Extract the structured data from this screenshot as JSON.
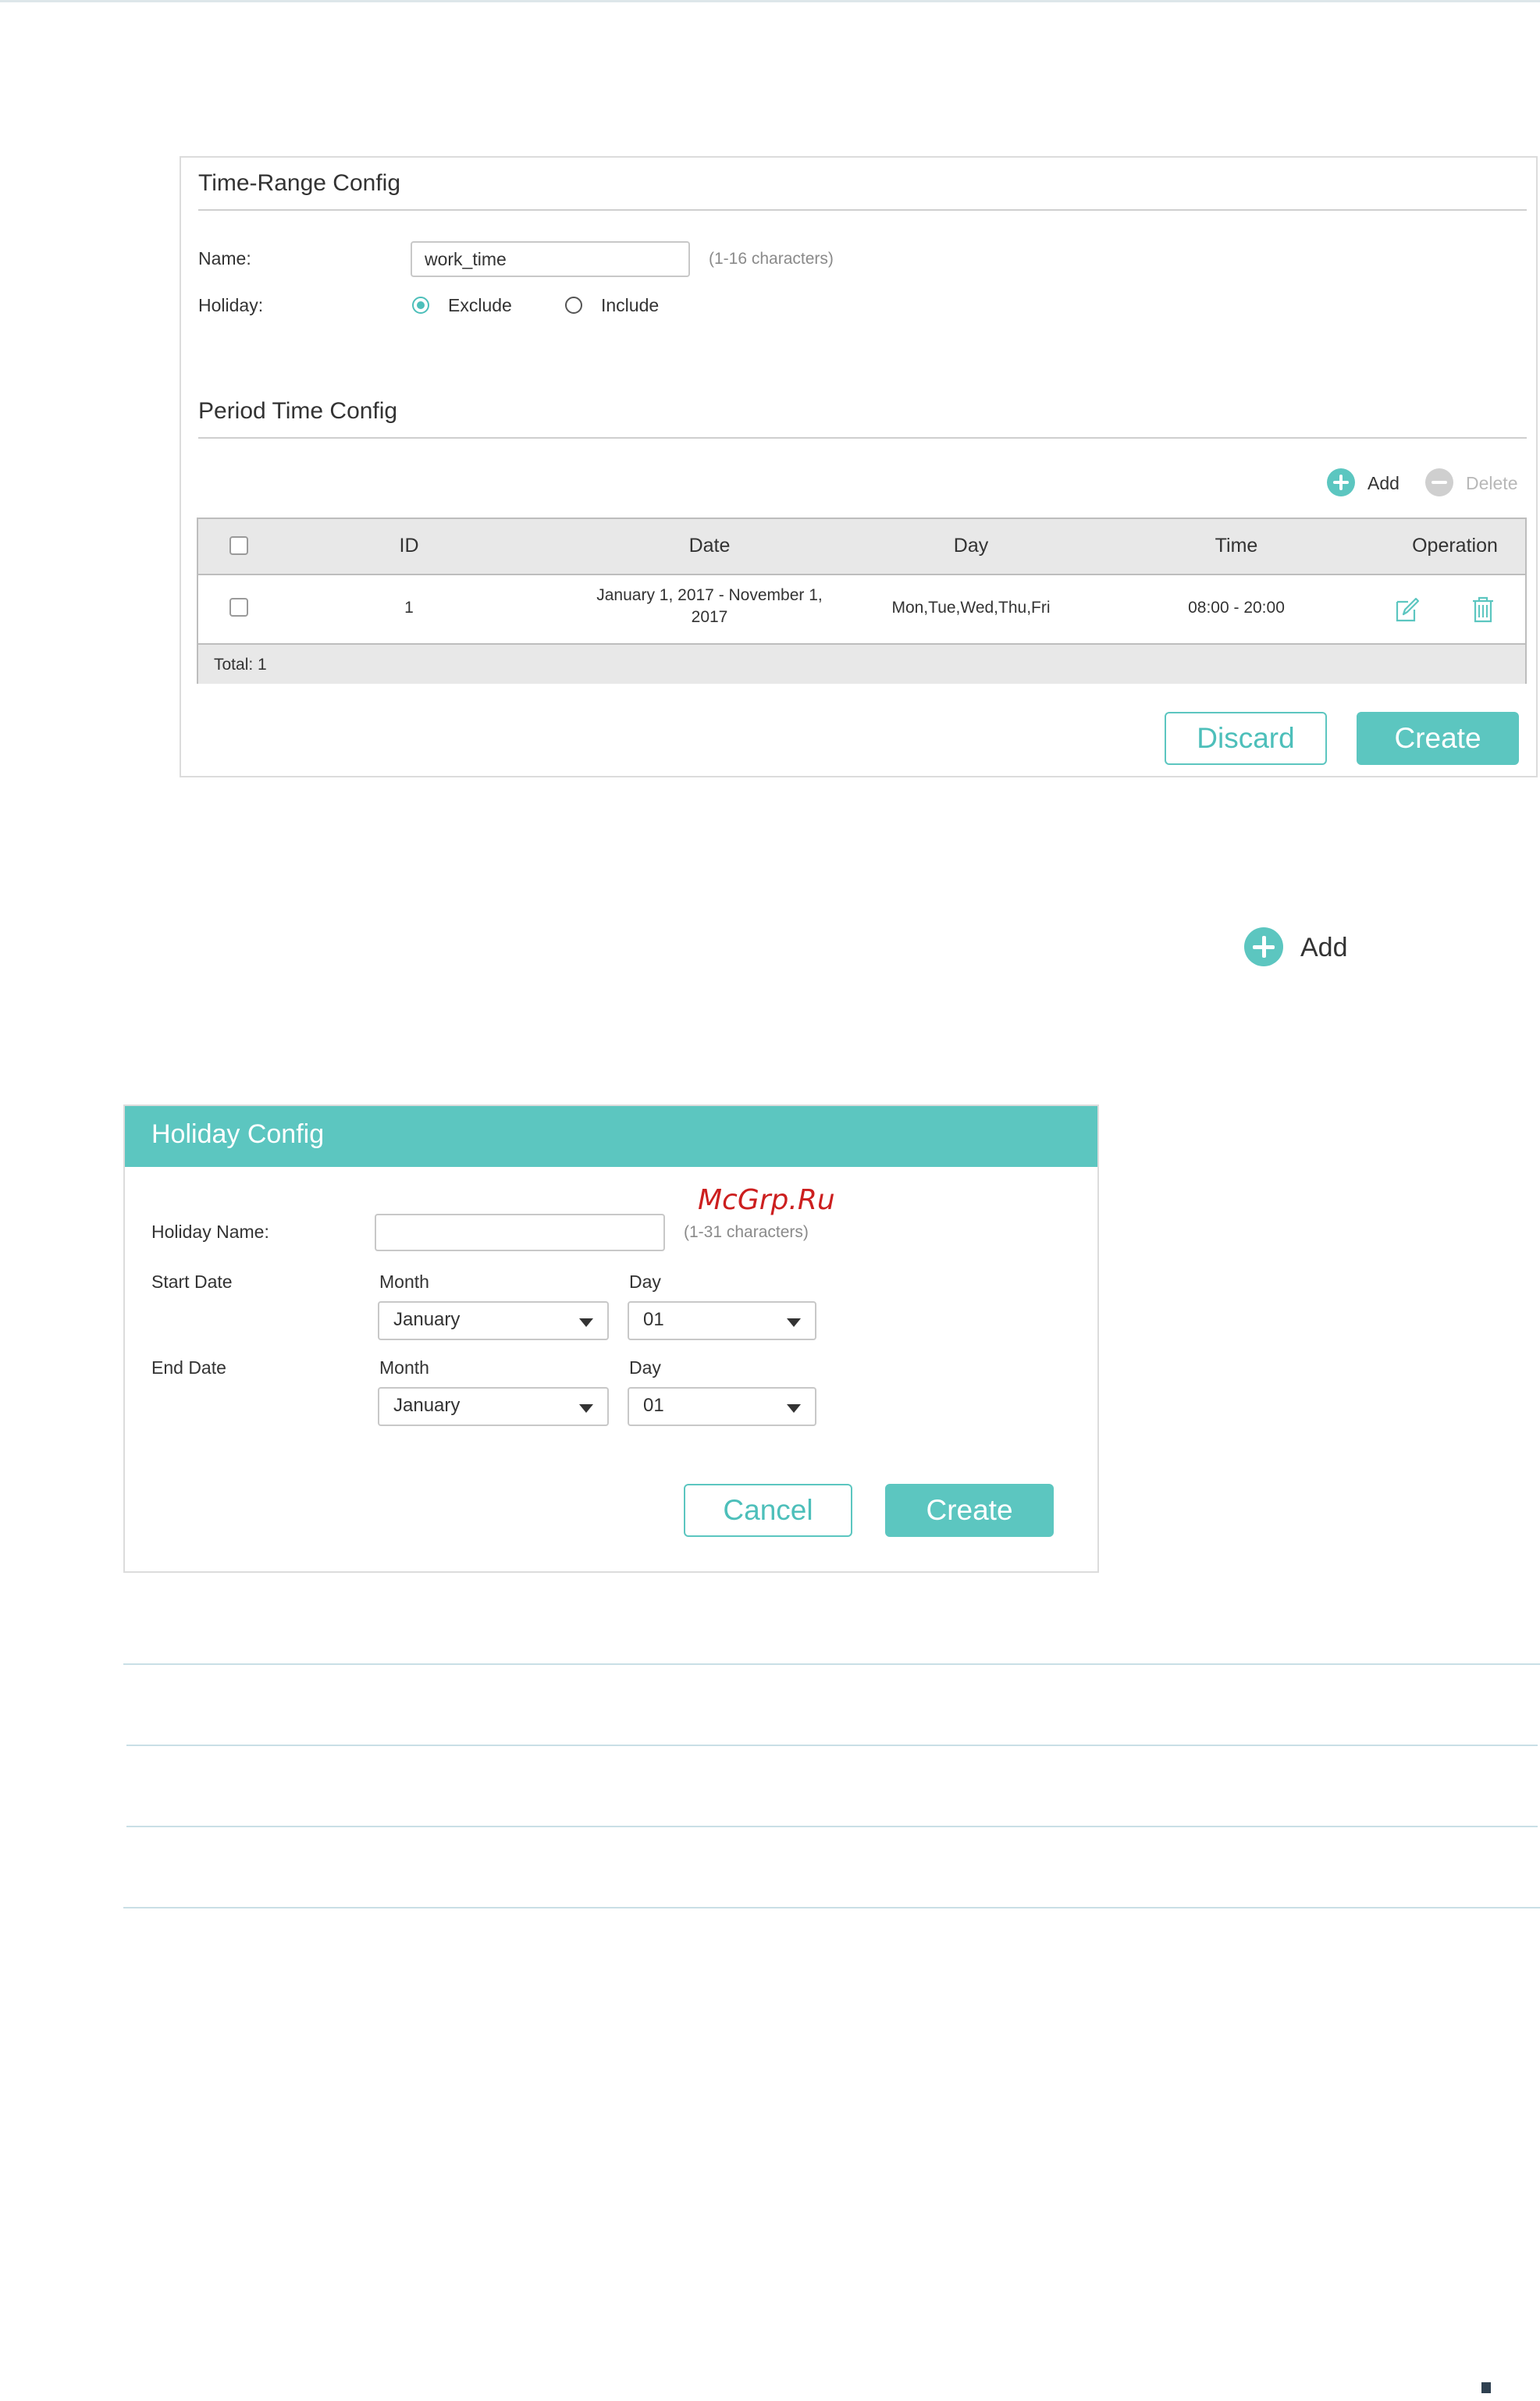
{
  "time_range": {
    "title": "Time-Range Config",
    "name_label": "Name:",
    "name_value": "work_time",
    "name_hint": "(1-16 characters)",
    "holiday_label": "Holiday:",
    "holiday_options": [
      {
        "label": "Exclude",
        "selected": true
      },
      {
        "label": "Include",
        "selected": false
      }
    ]
  },
  "period": {
    "title": "Period Time Config",
    "add_label": "Add",
    "delete_label": "Delete",
    "columns": [
      "ID",
      "Date",
      "Day",
      "Time",
      "Operation"
    ],
    "rows": [
      {
        "id": "1",
        "date_line1": "January 1, 2017 - November 1,",
        "date_line2": "2017",
        "day": "Mon,Tue,Wed,Thu,Fri",
        "time": "08:00 - 20:00",
        "operations": [
          "edit-icon",
          "trash-icon"
        ]
      }
    ],
    "total_text": "Total: 1"
  },
  "panel1_buttons": {
    "discard": "Discard",
    "create": "Create"
  },
  "standalone_add_label": "Add",
  "holiday": {
    "title": "Holiday Config",
    "watermark": "McGrp.Ru",
    "name_label": "Holiday Name:",
    "name_value": "",
    "name_hint": "(1-31 characters)",
    "start_label": "Start Date",
    "end_label": "End Date",
    "month_label": "Month",
    "day_label": "Day",
    "start_month": "January",
    "start_day": "01",
    "end_month": "January",
    "end_day": "01",
    "cancel": "Cancel",
    "create": "Create"
  },
  "colors": {
    "accent": "#5cc6c0",
    "border": "#dcdcdc",
    "header_bg": "#e8e8e8"
  }
}
